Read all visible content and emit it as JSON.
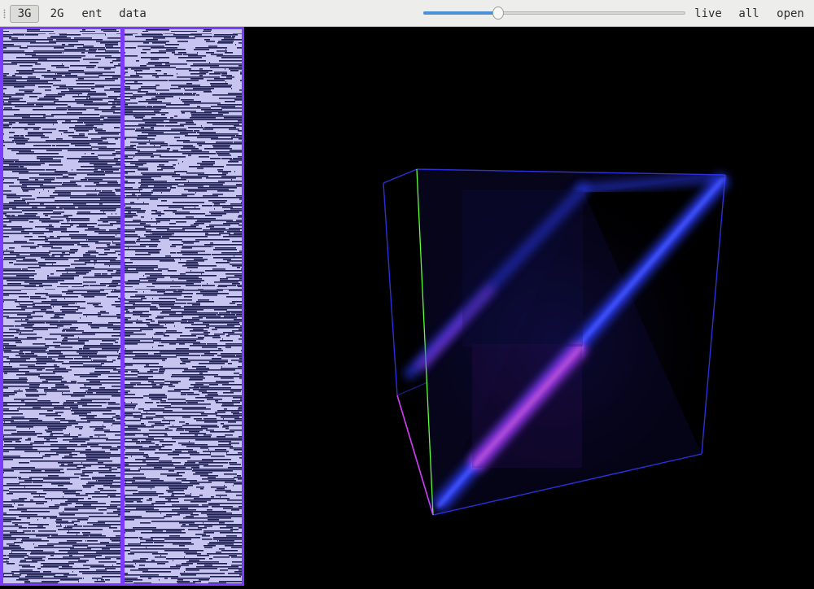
{
  "toolbar": {
    "buttons": [
      {
        "label": "3G",
        "active": true
      },
      {
        "label": "2G",
        "active": false
      },
      {
        "label": "ent",
        "active": false
      },
      {
        "label": "data",
        "active": false
      }
    ],
    "slider_value": 0.285,
    "right_buttons": [
      {
        "label": "live"
      },
      {
        "label": "all"
      },
      {
        "label": "open"
      }
    ]
  },
  "hexview": {
    "colors": {
      "frame": "#7a3bff",
      "light": "#c8c4f0",
      "dark": "#1e1e50"
    }
  },
  "viewer3d": {
    "colors": {
      "background": "#000000",
      "diagonal": "#2a3cff",
      "highlight": "#d03cff",
      "axis_y": "#5cff3a"
    }
  }
}
